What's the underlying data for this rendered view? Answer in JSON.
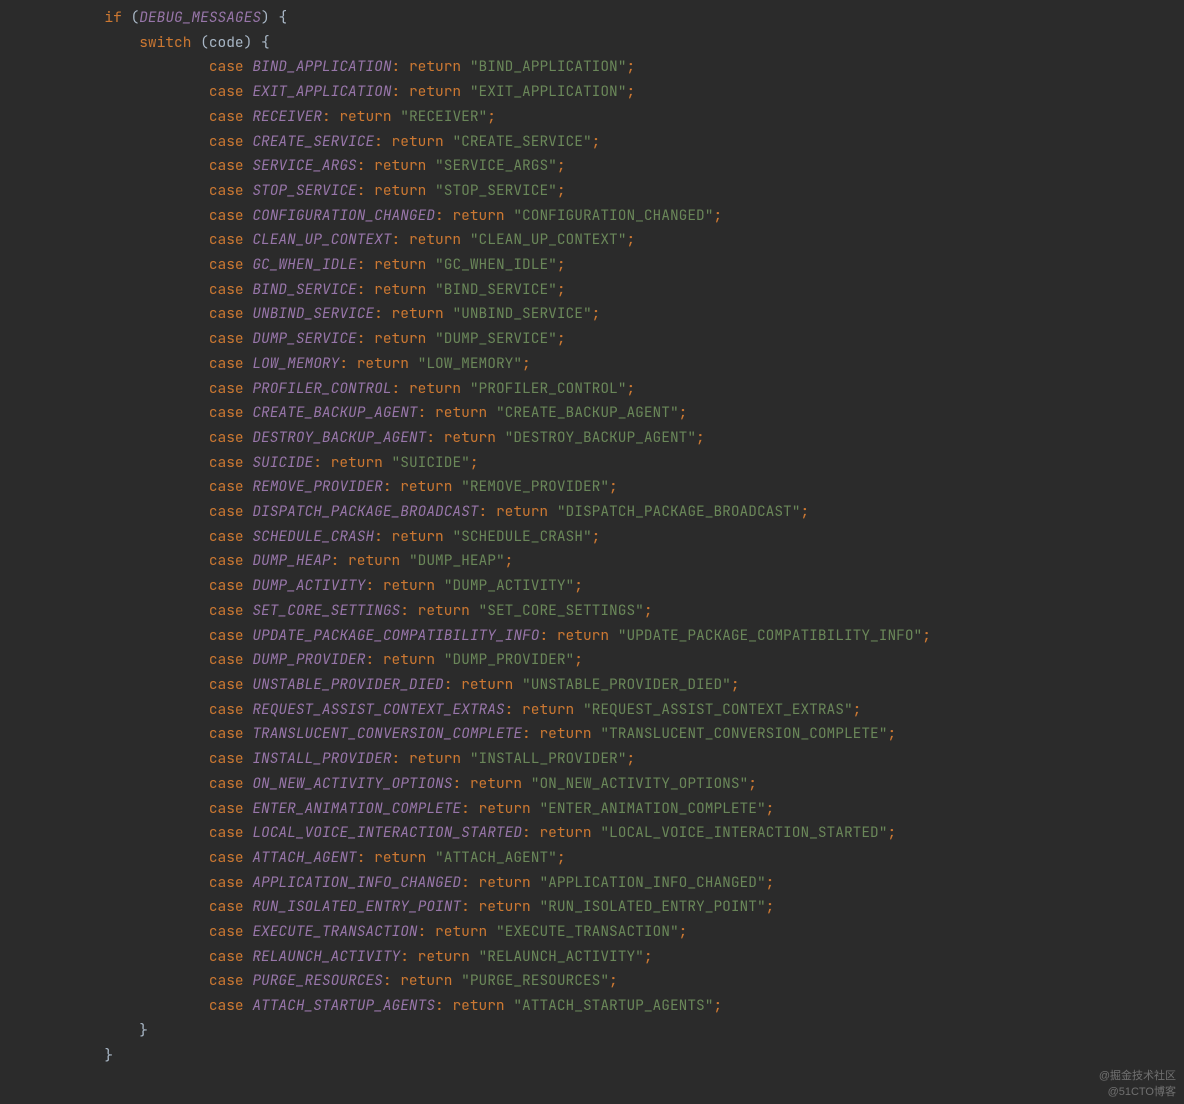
{
  "indent": {
    "base": "            ",
    "switch": "                ",
    "case": "                        ",
    "close_switch": "                ",
    "close_if": "            "
  },
  "tokens": {
    "if": "if",
    "switch": "switch",
    "case": "case",
    "return": "return",
    "debug_messages": "DEBUG_MESSAGES",
    "code_var": "code"
  },
  "cases": [
    {
      "name": "BIND_APPLICATION",
      "str": "\"BIND_APPLICATION\""
    },
    {
      "name": "EXIT_APPLICATION",
      "str": "\"EXIT_APPLICATION\""
    },
    {
      "name": "RECEIVER",
      "str": "\"RECEIVER\""
    },
    {
      "name": "CREATE_SERVICE",
      "str": "\"CREATE_SERVICE\""
    },
    {
      "name": "SERVICE_ARGS",
      "str": "\"SERVICE_ARGS\""
    },
    {
      "name": "STOP_SERVICE",
      "str": "\"STOP_SERVICE\""
    },
    {
      "name": "CONFIGURATION_CHANGED",
      "str": "\"CONFIGURATION_CHANGED\""
    },
    {
      "name": "CLEAN_UP_CONTEXT",
      "str": "\"CLEAN_UP_CONTEXT\""
    },
    {
      "name": "GC_WHEN_IDLE",
      "str": "\"GC_WHEN_IDLE\""
    },
    {
      "name": "BIND_SERVICE",
      "str": "\"BIND_SERVICE\""
    },
    {
      "name": "UNBIND_SERVICE",
      "str": "\"UNBIND_SERVICE\""
    },
    {
      "name": "DUMP_SERVICE",
      "str": "\"DUMP_SERVICE\""
    },
    {
      "name": "LOW_MEMORY",
      "str": "\"LOW_MEMORY\""
    },
    {
      "name": "PROFILER_CONTROL",
      "str": "\"PROFILER_CONTROL\""
    },
    {
      "name": "CREATE_BACKUP_AGENT",
      "str": "\"CREATE_BACKUP_AGENT\""
    },
    {
      "name": "DESTROY_BACKUP_AGENT",
      "str": "\"DESTROY_BACKUP_AGENT\""
    },
    {
      "name": "SUICIDE",
      "str": "\"SUICIDE\""
    },
    {
      "name": "REMOVE_PROVIDER",
      "str": "\"REMOVE_PROVIDER\""
    },
    {
      "name": "DISPATCH_PACKAGE_BROADCAST",
      "str": "\"DISPATCH_PACKAGE_BROADCAST\""
    },
    {
      "name": "SCHEDULE_CRASH",
      "str": "\"SCHEDULE_CRASH\""
    },
    {
      "name": "DUMP_HEAP",
      "str": "\"DUMP_HEAP\""
    },
    {
      "name": "DUMP_ACTIVITY",
      "str": "\"DUMP_ACTIVITY\""
    },
    {
      "name": "SET_CORE_SETTINGS",
      "str": "\"SET_CORE_SETTINGS\""
    },
    {
      "name": "UPDATE_PACKAGE_COMPATIBILITY_INFO",
      "str": "\"UPDATE_PACKAGE_COMPATIBILITY_INFO\""
    },
    {
      "name": "DUMP_PROVIDER",
      "str": "\"DUMP_PROVIDER\""
    },
    {
      "name": "UNSTABLE_PROVIDER_DIED",
      "str": "\"UNSTABLE_PROVIDER_DIED\""
    },
    {
      "name": "REQUEST_ASSIST_CONTEXT_EXTRAS",
      "str": "\"REQUEST_ASSIST_CONTEXT_EXTRAS\""
    },
    {
      "name": "TRANSLUCENT_CONVERSION_COMPLETE",
      "str": "\"TRANSLUCENT_CONVERSION_COMPLETE\""
    },
    {
      "name": "INSTALL_PROVIDER",
      "str": "\"INSTALL_PROVIDER\""
    },
    {
      "name": "ON_NEW_ACTIVITY_OPTIONS",
      "str": "\"ON_NEW_ACTIVITY_OPTIONS\""
    },
    {
      "name": "ENTER_ANIMATION_COMPLETE",
      "str": "\"ENTER_ANIMATION_COMPLETE\""
    },
    {
      "name": "LOCAL_VOICE_INTERACTION_STARTED",
      "str": "\"LOCAL_VOICE_INTERACTION_STARTED\""
    },
    {
      "name": "ATTACH_AGENT",
      "str": "\"ATTACH_AGENT\""
    },
    {
      "name": "APPLICATION_INFO_CHANGED",
      "str": "\"APPLICATION_INFO_CHANGED\""
    },
    {
      "name": "RUN_ISOLATED_ENTRY_POINT",
      "str": "\"RUN_ISOLATED_ENTRY_POINT\""
    },
    {
      "name": "EXECUTE_TRANSACTION",
      "str": "\"EXECUTE_TRANSACTION\""
    },
    {
      "name": "RELAUNCH_ACTIVITY",
      "str": "\"RELAUNCH_ACTIVITY\""
    },
    {
      "name": "PURGE_RESOURCES",
      "str": "\"PURGE_RESOURCES\""
    },
    {
      "name": "ATTACH_STARTUP_AGENTS",
      "str": "\"ATTACH_STARTUP_AGENTS\""
    }
  ],
  "watermarks": {
    "top": "@掘金技术社区",
    "bottom": "@51CTO博客"
  }
}
